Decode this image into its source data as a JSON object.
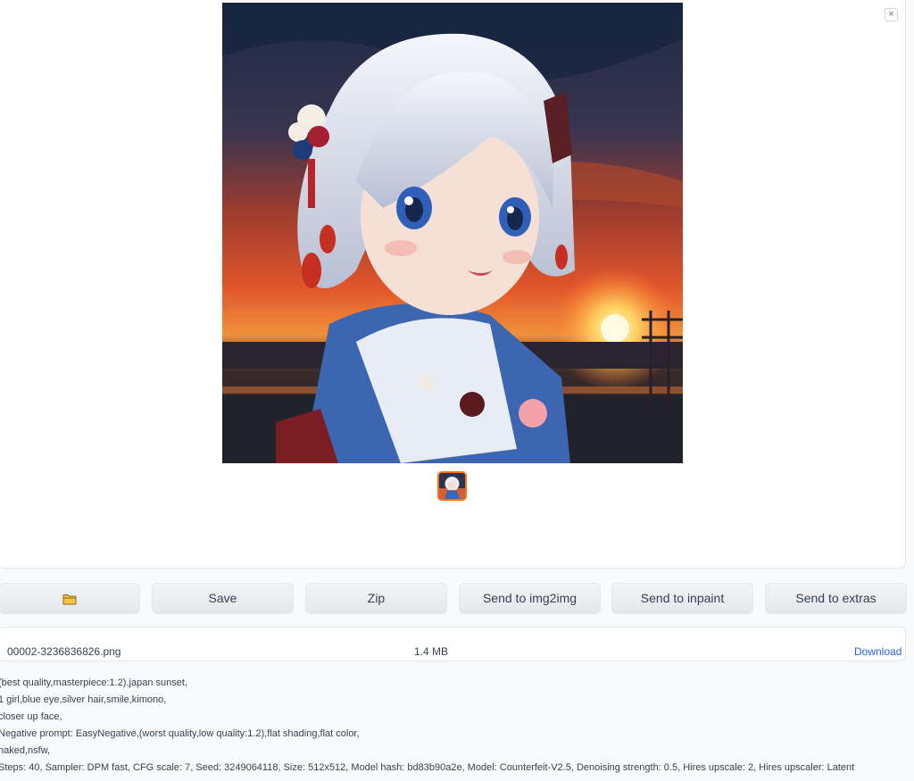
{
  "gallery": {
    "close_label": "×",
    "main_image_alt": "anime girl with silver hair in kimono at japan sunset",
    "thumbnail_alt": "thumbnail"
  },
  "buttons": {
    "folder_icon": "folder-icon",
    "save": "Save",
    "zip": "Zip",
    "send_img2img": "Send to img2img",
    "send_inpaint": "Send to inpaint",
    "send_extras": "Send to extras"
  },
  "file": {
    "name": "00002-3236836826.png",
    "size": "1.4 MB",
    "download": "Download"
  },
  "info_lines": [
    "(best quality,masterpiece:1.2),japan sunset,",
    "1 girl,blue eye,silver hair,smile,kimono,",
    "closer up face,",
    "Negative prompt: EasyNegative,(worst quality,low quality:1.2),flat shading,flat color,",
    "naked,nsfw,",
    "Steps: 40, Sampler: DPM fast, CFG scale: 7, Seed: 3249064118, Size: 512x512, Model hash: bd83b90a2e, Model: Counterfeit-V2.5, Denoising strength: 0.5, Hires upscale: 2, Hires upscaler: Latent"
  ],
  "colors": {
    "accent": "#f97316",
    "link": "#2563eb"
  }
}
